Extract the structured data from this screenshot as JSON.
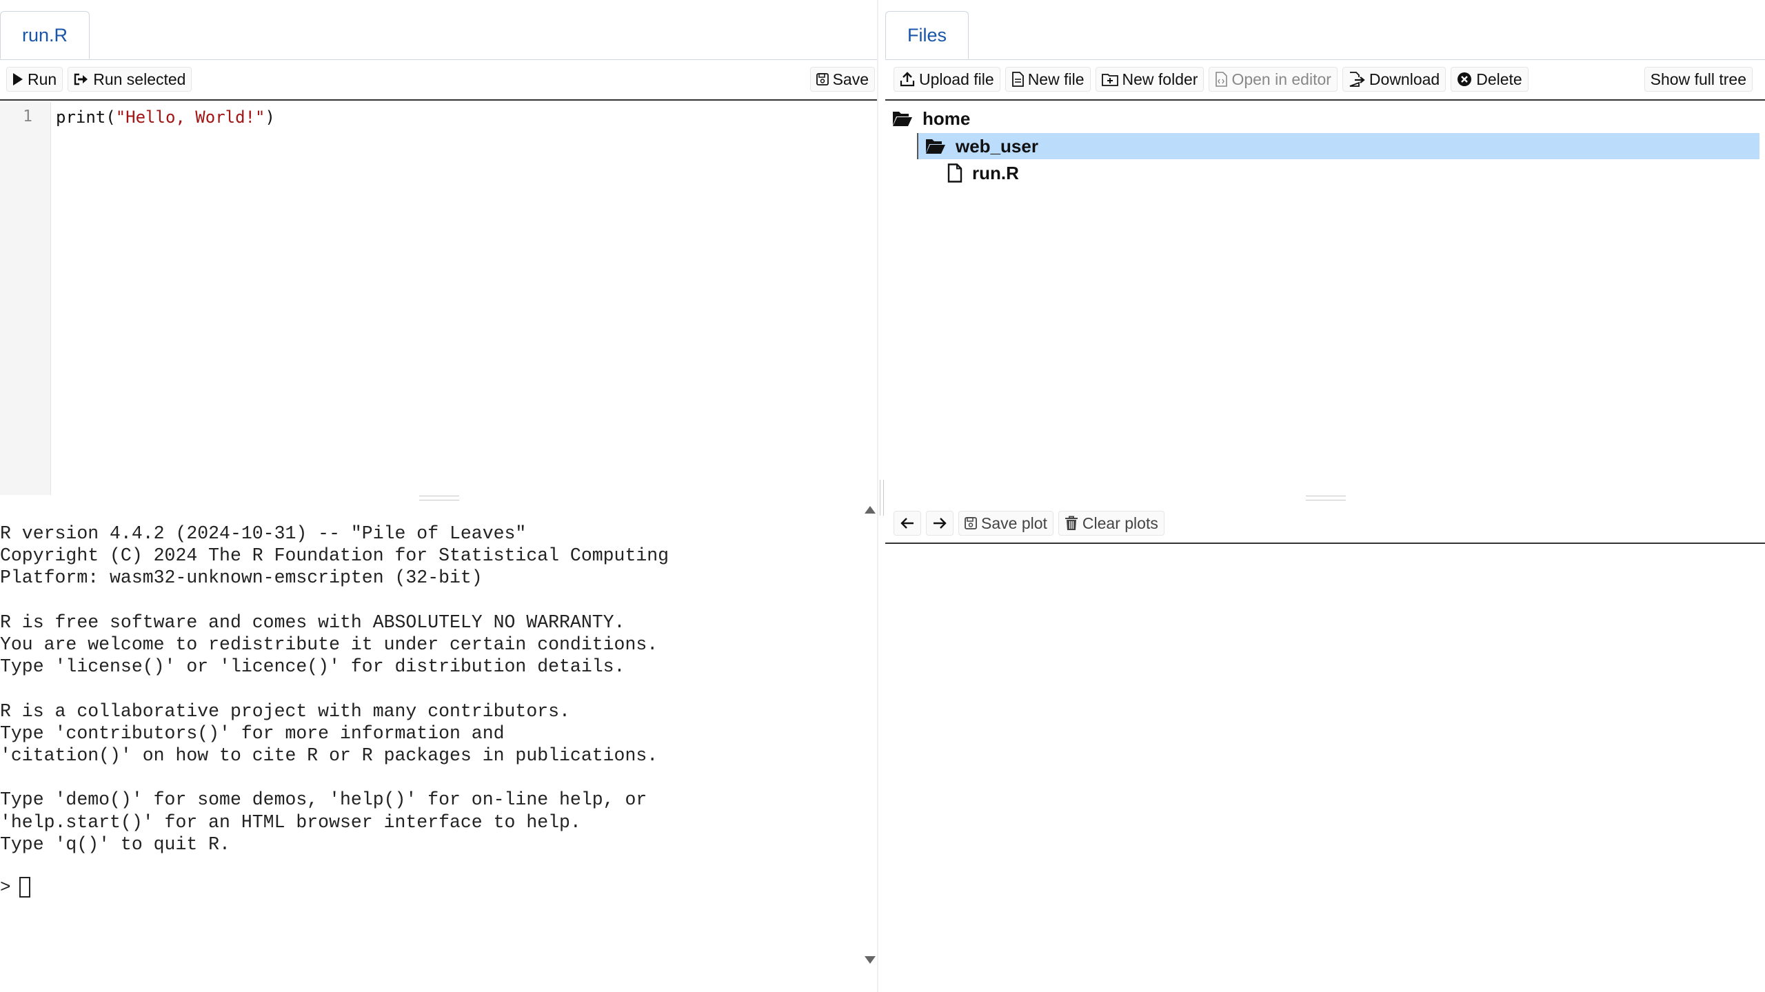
{
  "editor": {
    "tab_label": "run.R",
    "toolbar": {
      "run_label": "Run",
      "run_selected_label": "Run selected",
      "save_label": "Save"
    },
    "line_number": "1",
    "code": {
      "fn": "print(",
      "string": "\"Hello, World!\"",
      "close": ")"
    }
  },
  "console": {
    "lines": [
      "R version 4.4.2 (2024-10-31) -- \"Pile of Leaves\"",
      "Copyright (C) 2024 The R Foundation for Statistical Computing",
      "Platform: wasm32-unknown-emscripten (32-bit)",
      "",
      "R is free software and comes with ABSOLUTELY NO WARRANTY.",
      "You are welcome to redistribute it under certain conditions.",
      "Type 'license()' or 'licence()' for distribution details.",
      "",
      "R is a collaborative project with many contributors.",
      "Type 'contributors()' for more information and",
      "'citation()' on how to cite R or R packages in publications.",
      "",
      "Type 'demo()' for some demos, 'help()' for on-line help, or",
      "'help.start()' for an HTML browser interface to help.",
      "Type 'q()' to quit R."
    ],
    "prompt": ">"
  },
  "files": {
    "tab_label": "Files",
    "toolbar": {
      "upload_label": "Upload file",
      "new_file_label": "New file",
      "new_folder_label": "New folder",
      "open_in_editor_label": "Open in editor",
      "download_label": "Download",
      "delete_label": "Delete",
      "show_full_tree_label": "Show full tree"
    },
    "tree": {
      "root": "home",
      "folder": "web_user",
      "file": "run.R"
    },
    "selection_color": "#bcdcfc"
  },
  "plots": {
    "toolbar": {
      "save_plot_label": "Save plot",
      "clear_plots_label": "Clear plots"
    }
  },
  "icons": [
    "play-icon",
    "run-selected-icon",
    "save-icon",
    "upload-icon",
    "file-icon",
    "folder-plus-icon",
    "open-editor-icon",
    "download-icon",
    "delete-icon",
    "folder-open-icon",
    "arrow-left-icon",
    "arrow-right-icon",
    "trash-icon"
  ]
}
